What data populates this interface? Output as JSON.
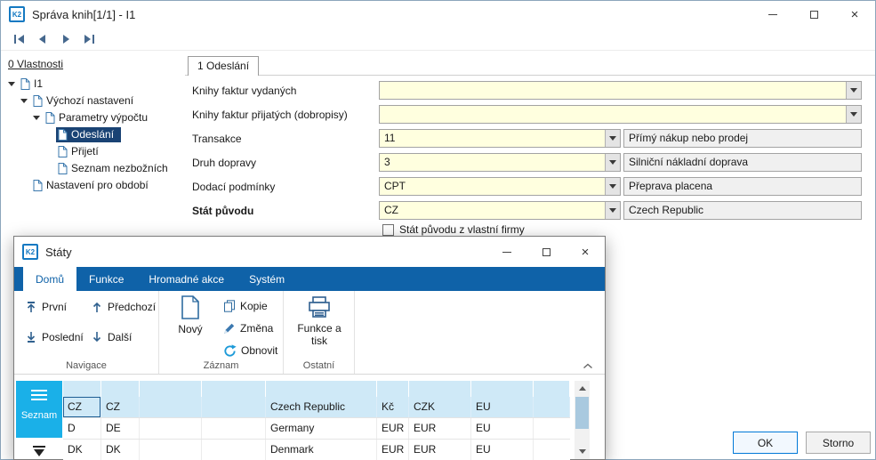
{
  "main_window": {
    "logo": "K2",
    "title": "Správa knih[1/1] - I1",
    "properties_label": "0 Vlastnosti",
    "tree": {
      "items": [
        {
          "label": "I1"
        },
        {
          "label": "Výchozí nastavení"
        },
        {
          "label": "Parametry výpočtu"
        },
        {
          "label": "Odeslání"
        },
        {
          "label": "Přijetí"
        },
        {
          "label": "Seznam nezbožních"
        },
        {
          "label": "Nastavení pro období"
        }
      ]
    },
    "tab_label": "1 Odeslání",
    "form": {
      "rows": [
        {
          "label": "Knihy faktur vydaných",
          "value": "",
          "desc": ""
        },
        {
          "label": "Knihy faktur přijatých (dobropisy)",
          "value": "",
          "desc": ""
        },
        {
          "label": "Transakce",
          "value": "11",
          "desc": "Přímý nákup nebo prodej"
        },
        {
          "label": "Druh dopravy",
          "value": "3",
          "desc": "Silniční nákladní doprava"
        },
        {
          "label": "Dodací podmínky",
          "value": "CPT",
          "desc": "Přeprava placena"
        },
        {
          "label": "Stát původu",
          "value": "CZ",
          "desc": "Czech Republic"
        }
      ],
      "checkbox_label": "Stát původu z vlastní firmy"
    },
    "ok_label": "OK",
    "cancel_label": "Storno"
  },
  "states_window": {
    "logo": "K2",
    "title": "Státy",
    "ribbon": {
      "tabs": [
        {
          "label": "Domů"
        },
        {
          "label": "Funkce"
        },
        {
          "label": "Hromadné akce"
        },
        {
          "label": "Systém"
        }
      ],
      "nav": {
        "first": "První",
        "prev": "Předchozí",
        "last": "Poslední",
        "next": "Další"
      },
      "record": {
        "new": "Nový",
        "copy": "Kopie",
        "edit": "Změna",
        "refresh": "Obnovit"
      },
      "other": {
        "print": "Funkce a tisk"
      },
      "groups": {
        "nav": "Navigace",
        "record": "Záznam",
        "other": "Ostatní"
      }
    },
    "sidebar": {
      "list_label": "Seznam"
    },
    "grid": {
      "rows": [
        [
          "CZ",
          "CZ",
          "",
          "",
          "Czech Republic",
          "Kč",
          "CZK",
          "EU",
          ""
        ],
        [
          "D",
          "DE",
          "",
          "",
          "Germany",
          "EUR",
          "EUR",
          "EU",
          ""
        ],
        [
          "DK",
          "DK",
          "",
          "",
          "Denmark",
          "EUR",
          "EUR",
          "EU",
          ""
        ]
      ]
    }
  }
}
